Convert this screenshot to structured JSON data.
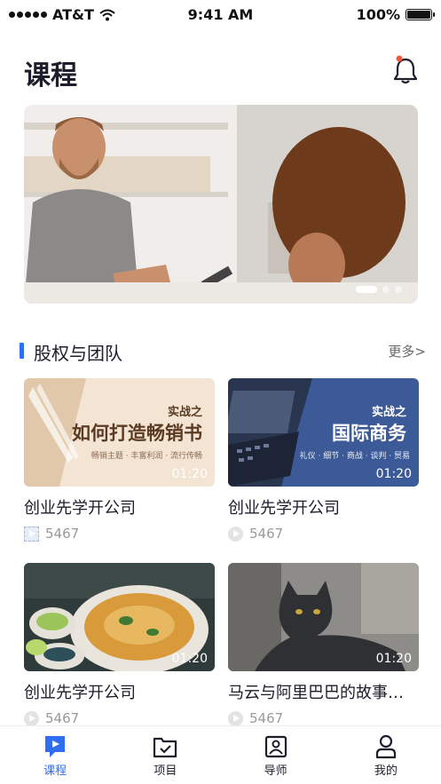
{
  "status_bar": {
    "carrier": "AT&T",
    "time": "9:41 AM",
    "battery": "100%"
  },
  "header": {
    "title": "课程"
  },
  "banner": {
    "slide_count": 3,
    "active_slide": 1
  },
  "section": {
    "title": "股权与团队",
    "more": "更多>"
  },
  "cards": [
    {
      "title": "创业先学开公司",
      "views": "5467",
      "duration": "01:20",
      "thumb_line1": "实战之",
      "thumb_line2": "如何打造畅销书",
      "thumb_line3": "畅销主题 · 丰富利润 · 流行传畅"
    },
    {
      "title": "创业先学开公司",
      "views": "5467",
      "duration": "01:20",
      "thumb_line1": "实战之",
      "thumb_line2": "国际商务",
      "thumb_line3": "礼仪 · 细节 · 商战 · 谈判 · 贸易"
    },
    {
      "title": "创业先学开公司",
      "views": "5467",
      "duration": "01:20"
    },
    {
      "title": "马云与阿里巴巴的故事吼...",
      "views": "5467",
      "duration": "01:20"
    }
  ],
  "tabs": [
    {
      "label": "课程",
      "icon": "course-icon",
      "active": true
    },
    {
      "label": "项目",
      "icon": "project-icon",
      "active": false
    },
    {
      "label": "导师",
      "icon": "mentor-icon",
      "active": false
    },
    {
      "label": "我的",
      "icon": "profile-icon",
      "active": false
    }
  ],
  "colors": {
    "accent": "#2f6ef2",
    "notification_dot": "#f05a3c",
    "text": "#1d1d2b"
  }
}
